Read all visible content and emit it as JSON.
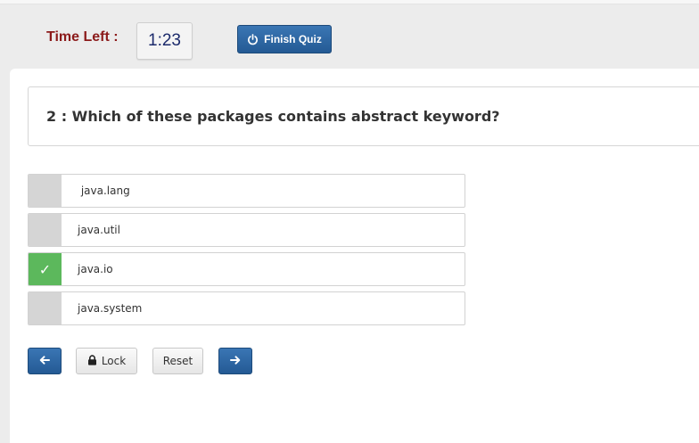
{
  "timer": {
    "label": "Time Left :",
    "value": "1:23"
  },
  "toolbar": {
    "finish_label": "Finish Quiz",
    "finish_icon": "power-icon"
  },
  "question": {
    "text": "2 : Which of these packages contains abstract keyword?"
  },
  "options": [
    {
      "label": " java.lang",
      "selected": false
    },
    {
      "label": "java.util",
      "selected": false
    },
    {
      "label": "java.io",
      "selected": true,
      "mark": "✓"
    },
    {
      "label": "java.system",
      "selected": false
    }
  ],
  "nav": {
    "prev_icon": "arrow-left-icon",
    "lock_label": "Lock",
    "lock_icon": "lock-icon",
    "reset_label": "Reset",
    "next_icon": "arrow-right-icon"
  },
  "colors": {
    "primary_button": "#2b65a3",
    "timer_label": "#8b1a1a",
    "selected_marker": "#5cb85c",
    "unselected_marker": "#d5d5d5"
  }
}
